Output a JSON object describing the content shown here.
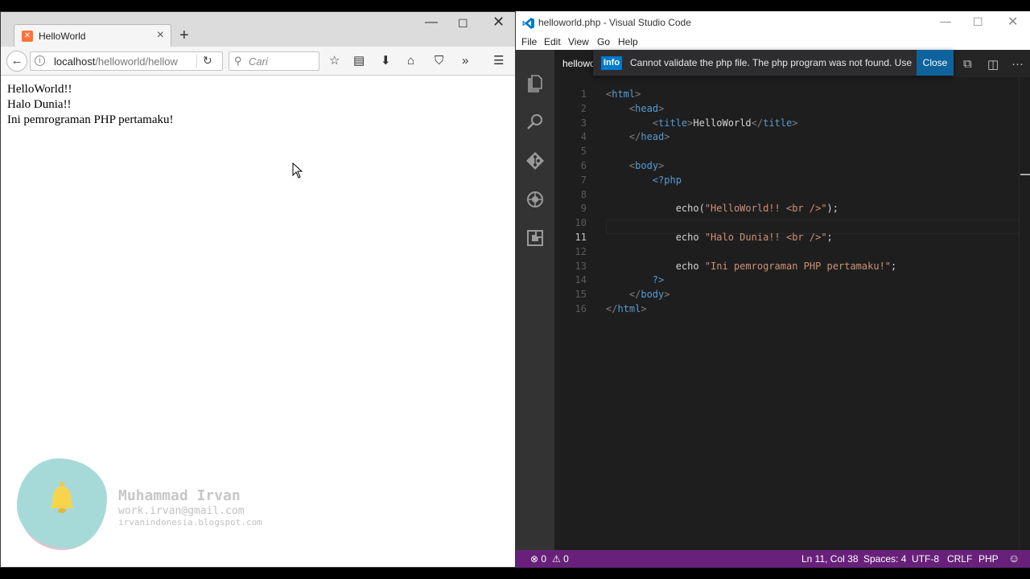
{
  "firefox": {
    "tab_title": "HelloWorld",
    "url_host": "localhost",
    "url_path": "/helloworld/hellow",
    "search_placeholder": "Cari",
    "page_lines": [
      "HelloWorld!!",
      "Halo Dunia!!",
      "Ini pemrograman PHP pertamaku!"
    ],
    "watermark": {
      "name": "Muhammad Irvan",
      "email": "work.irvan@gmail.com",
      "blog": "irvanindonesia.blogspot.com"
    }
  },
  "vscode": {
    "window_title": "helloworld.php - Visual Studio Code",
    "menu": [
      "File",
      "Edit",
      "View",
      "Go",
      "Help"
    ],
    "tab_label": "helloworld.php",
    "notification": {
      "badge": "Info",
      "message": "Cannot validate the php file. The php program was not found. Use the 'php.validate.executablePath' setting to configure the location of 'php'",
      "close_label": "Close"
    },
    "line_numbers": [
      "1",
      "2",
      "3",
      "4",
      "5",
      "6",
      "7",
      "8",
      "9",
      "10",
      "11",
      "12",
      "13",
      "14",
      "15",
      "16"
    ],
    "active_line": 11,
    "code": [
      [
        [
          "brk",
          "<"
        ],
        [
          "tag",
          "html"
        ],
        [
          "brk",
          ">"
        ]
      ],
      [
        [
          "txt",
          "    "
        ],
        [
          "brk",
          "<"
        ],
        [
          "tag",
          "head"
        ],
        [
          "brk",
          ">"
        ]
      ],
      [
        [
          "txt",
          "        "
        ],
        [
          "brk",
          "<"
        ],
        [
          "tag",
          "title"
        ],
        [
          "brk",
          ">"
        ],
        [
          "txt",
          "HelloWorld"
        ],
        [
          "brk",
          "</"
        ],
        [
          "tag",
          "title"
        ],
        [
          "brk",
          ">"
        ]
      ],
      [
        [
          "txt",
          "    "
        ],
        [
          "brk",
          "</"
        ],
        [
          "tag",
          "head"
        ],
        [
          "brk",
          ">"
        ]
      ],
      [],
      [
        [
          "txt",
          "    "
        ],
        [
          "brk",
          "<"
        ],
        [
          "tag",
          "body"
        ],
        [
          "brk",
          ">"
        ]
      ],
      [
        [
          "txt",
          "        "
        ],
        [
          "tag",
          "<?php"
        ]
      ],
      [],
      [
        [
          "txt",
          "            "
        ],
        [
          "fn",
          "echo("
        ],
        [
          "str",
          "\"HelloWorld!! <br />\""
        ],
        [
          "fn",
          ");"
        ]
      ],
      [],
      [
        [
          "txt",
          "            "
        ],
        [
          "fn",
          "echo "
        ],
        [
          "str",
          "\"Halo Dunia!! <br />\""
        ],
        [
          "fn",
          ";"
        ]
      ],
      [],
      [
        [
          "txt",
          "            "
        ],
        [
          "fn",
          "echo "
        ],
        [
          "str",
          "\"Ini pemrograman PHP pertamaku!\""
        ],
        [
          "fn",
          ";"
        ]
      ],
      [
        [
          "txt",
          "        "
        ],
        [
          "tag",
          "?>"
        ]
      ],
      [
        [
          "txt",
          "    "
        ],
        [
          "brk",
          "</"
        ],
        [
          "tag",
          "body"
        ],
        [
          "brk",
          ">"
        ]
      ],
      [
        [
          "brk",
          "</"
        ],
        [
          "tag",
          "html"
        ],
        [
          "brk",
          ">"
        ]
      ]
    ],
    "status": {
      "errors": "0",
      "warnings": "0",
      "position": "Ln 11, Col 38",
      "spaces": "Spaces: 4",
      "encoding": "UTF-8",
      "eol": "CRLF",
      "language": "PHP"
    },
    "colors": {
      "status_bar": "#68217a",
      "accent": "#007acc"
    }
  }
}
